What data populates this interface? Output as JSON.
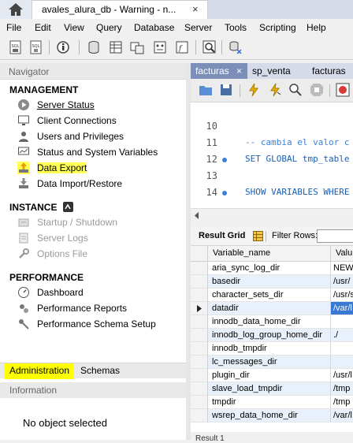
{
  "window": {
    "tab_title": "avales_alura_db - Warning - n...",
    "tab_close": "×"
  },
  "menu": [
    "File",
    "Edit",
    "View",
    "Query",
    "Database",
    "Server",
    "Tools",
    "Scripting",
    "Help"
  ],
  "navigator": {
    "header": "Navigator",
    "management": {
      "title": "MANAGEMENT",
      "items": [
        "Server Status",
        "Client Connections",
        "Users and Privileges",
        "Status and System Variables",
        "Data Export",
        "Data Import/Restore"
      ]
    },
    "instance": {
      "title": "INSTANCE",
      "items": [
        "Startup / Shutdown",
        "Server Logs",
        "Options File"
      ]
    },
    "performance": {
      "title": "PERFORMANCE",
      "items": [
        "Dashboard",
        "Performance Reports",
        "Performance Schema Setup"
      ]
    },
    "tabs": {
      "administration": "Administration",
      "schemas": "Schemas"
    },
    "info_header": "Information",
    "info_text": "No object selected"
  },
  "editor": {
    "tabs": [
      "facturas",
      "sp_venta",
      "facturas"
    ],
    "tab_close": "×",
    "lines": [
      {
        "num": "10",
        "text": "",
        "dot": false
      },
      {
        "num": "11",
        "text": "-- cambia el valor c",
        "dot": false,
        "type": "comment"
      },
      {
        "num": "12",
        "text": "SET GLOBAL tmp_table",
        "dot": true,
        "type": "code"
      },
      {
        "num": "13",
        "text": "",
        "dot": false
      },
      {
        "num": "14",
        "text": "SHOW VARIABLES WHERE",
        "dot": true,
        "type": "code"
      },
      {
        "num": "",
        "text": "",
        "dot": false
      }
    ]
  },
  "result": {
    "grid_label": "Result Grid",
    "filter_label": "Filter Rows:",
    "columns": [
      "Variable_name",
      "Valu"
    ],
    "rows": [
      [
        "aria_sync_log_dir",
        "NEWF"
      ],
      [
        "basedir",
        "/usr/"
      ],
      [
        "character_sets_dir",
        "/usr/s"
      ],
      [
        "datadir",
        "/var/l"
      ],
      [
        "innodb_data_home_dir",
        ""
      ],
      [
        "innodb_log_group_home_dir",
        "./"
      ],
      [
        "innodb_tmpdir",
        ""
      ],
      [
        "lc_messages_dir",
        ""
      ],
      [
        "plugin_dir",
        "/usr/l"
      ],
      [
        "slave_load_tmpdir",
        "/tmp"
      ],
      [
        "tmpdir",
        "/tmp"
      ],
      [
        "wsrep_data_home_dir",
        "/var/l"
      ]
    ],
    "bottom_tab": "Result 1"
  },
  "colors": {
    "highlight": "#ffff55",
    "accent": "#3a78d4",
    "active_tab": "#7b8fb8"
  }
}
